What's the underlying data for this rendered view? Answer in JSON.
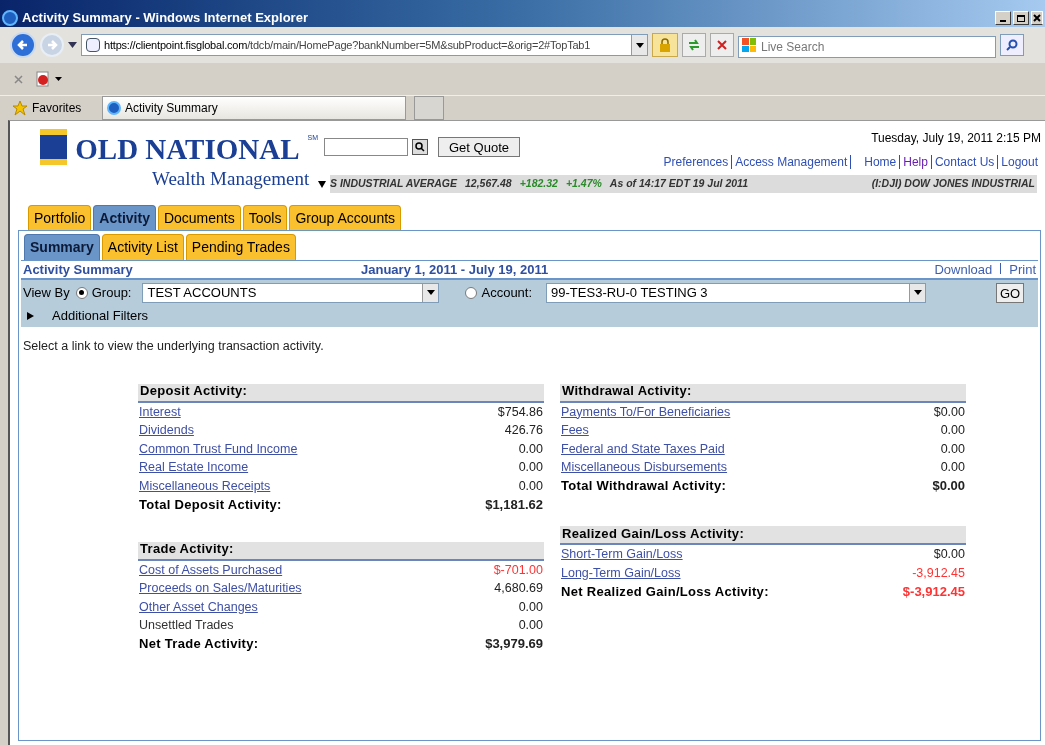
{
  "window": {
    "title": "Activity Summary - Windows Internet Explorer"
  },
  "browser": {
    "address_host": "https://clientpoint.",
    "address_bold": "fisglobal.com",
    "address_path": "/tdcb/main/HomePage?bankNumber=5M&subProduct=&orig=2#TopTab1",
    "search_placeholder": "Live Search",
    "favorites": "Favorites",
    "tab": "Activity Summary"
  },
  "header": {
    "logo": "OLD NATIONAL",
    "logo_mark": "SM",
    "logo_sub": "Wealth Management",
    "quote_button": "Get Quote",
    "date": "Tuesday, July 19, 2011 2:15 PM",
    "nav": [
      {
        "label": "Preferences",
        "visited": false
      },
      {
        "label": "Access Management",
        "visited": false
      },
      {
        "label": "Home",
        "visited": false
      },
      {
        "label": "Help",
        "visited": true
      },
      {
        "label": "Contact Us",
        "visited": false
      },
      {
        "label": "Logout",
        "visited": false
      }
    ],
    "ticker": [
      {
        "text": "S INDUSTRIAL AVERAGE",
        "kind": "plain"
      },
      {
        "text": "12,567.48",
        "kind": "plain"
      },
      {
        "text": "+182.32",
        "kind": "up"
      },
      {
        "text": "+1.47%",
        "kind": "up"
      },
      {
        "text": "As of 14:17 EDT 19 Jul 2011",
        "kind": "plain"
      },
      {
        "text": "(I:DJI) DOW JONES INDUSTRIAL",
        "kind": "plain"
      }
    ]
  },
  "main_tabs": [
    {
      "label": "Portfolio",
      "selected": false
    },
    {
      "label": "Activity",
      "selected": true
    },
    {
      "label": "Documents",
      "selected": false
    },
    {
      "label": "Tools",
      "selected": false
    },
    {
      "label": "Group Accounts",
      "selected": false
    }
  ],
  "sub_tabs": [
    {
      "label": "Summary",
      "selected": true
    },
    {
      "label": "Activity List",
      "selected": false
    },
    {
      "label": "Pending Trades",
      "selected": false
    }
  ],
  "panel": {
    "title": "Activity Summary",
    "date_range": "January 1, 2011 - July 19, 2011",
    "actions": [
      "Download",
      "Print"
    ],
    "view_by": "View By",
    "group": {
      "label": "Group:",
      "selected": true,
      "value": "TEST ACCOUNTS"
    },
    "account": {
      "label": "Account:",
      "selected": false,
      "value": "99-TES3-RU-0 TESTING 3"
    },
    "go_button": "GO",
    "filters": "Additional Filters",
    "instruction": "Select a link to view the underlying transaction activity."
  },
  "columns": [
    [
      {
        "title": "Deposit Activity:",
        "rows": [
          {
            "label": "Interest",
            "value": "$754.86",
            "kind": "link",
            "negative": false
          },
          {
            "label": "Dividends",
            "value": "426.76",
            "kind": "link",
            "negative": false
          },
          {
            "label": "Common Trust Fund Income",
            "value": "0.00",
            "kind": "link",
            "negative": false
          },
          {
            "label": "Real Estate Income",
            "value": "0.00",
            "kind": "link",
            "negative": false
          },
          {
            "label": "Miscellaneous Receipts",
            "value": "0.00",
            "kind": "link",
            "negative": false
          },
          {
            "label": "Total Deposit Activity:",
            "value": "$1,181.62",
            "kind": "total",
            "negative": false
          }
        ]
      },
      {
        "title": "Trade Activity:",
        "rows": [
          {
            "label": "Cost of Assets Purchased",
            "value": "$-701.00",
            "kind": "link",
            "negative": true
          },
          {
            "label": "Proceeds on Sales/Maturities",
            "value": "4,680.69",
            "kind": "link",
            "negative": false
          },
          {
            "label": "Other Asset Changes",
            "value": "0.00",
            "kind": "link",
            "negative": false
          },
          {
            "label": "Unsettled Trades",
            "value": "0.00",
            "kind": "text",
            "negative": false
          },
          {
            "label": "Net Trade Activity:",
            "value": "$3,979.69",
            "kind": "total",
            "negative": false
          }
        ]
      }
    ],
    [
      {
        "title": "Withdrawal Activity:",
        "rows": [
          {
            "label": "Payments To/For Beneficiaries",
            "value": "$0.00",
            "kind": "link",
            "negative": false
          },
          {
            "label": "Fees",
            "value": "0.00",
            "kind": "link",
            "negative": false
          },
          {
            "label": "Federal and State Taxes Paid",
            "value": "0.00",
            "kind": "link",
            "negative": false
          },
          {
            "label": "Miscellaneous Disbursements",
            "value": "0.00",
            "kind": "link",
            "negative": false
          },
          {
            "label": "Total Withdrawal Activity:",
            "value": "$0.00",
            "kind": "total",
            "negative": false
          }
        ]
      },
      {
        "title": "Realized Gain/Loss Activity:",
        "rows": [
          {
            "label": "Short-Term Gain/Loss",
            "value": "$0.00",
            "kind": "link",
            "negative": false
          },
          {
            "label": "Long-Term Gain/Loss",
            "value": "-3,912.45",
            "kind": "link",
            "negative": true
          },
          {
            "label": "Net Realized Gain/Loss Activity:",
            "value": "$-3,912.45",
            "kind": "total",
            "negative": true
          }
        ]
      }
    ]
  ]
}
